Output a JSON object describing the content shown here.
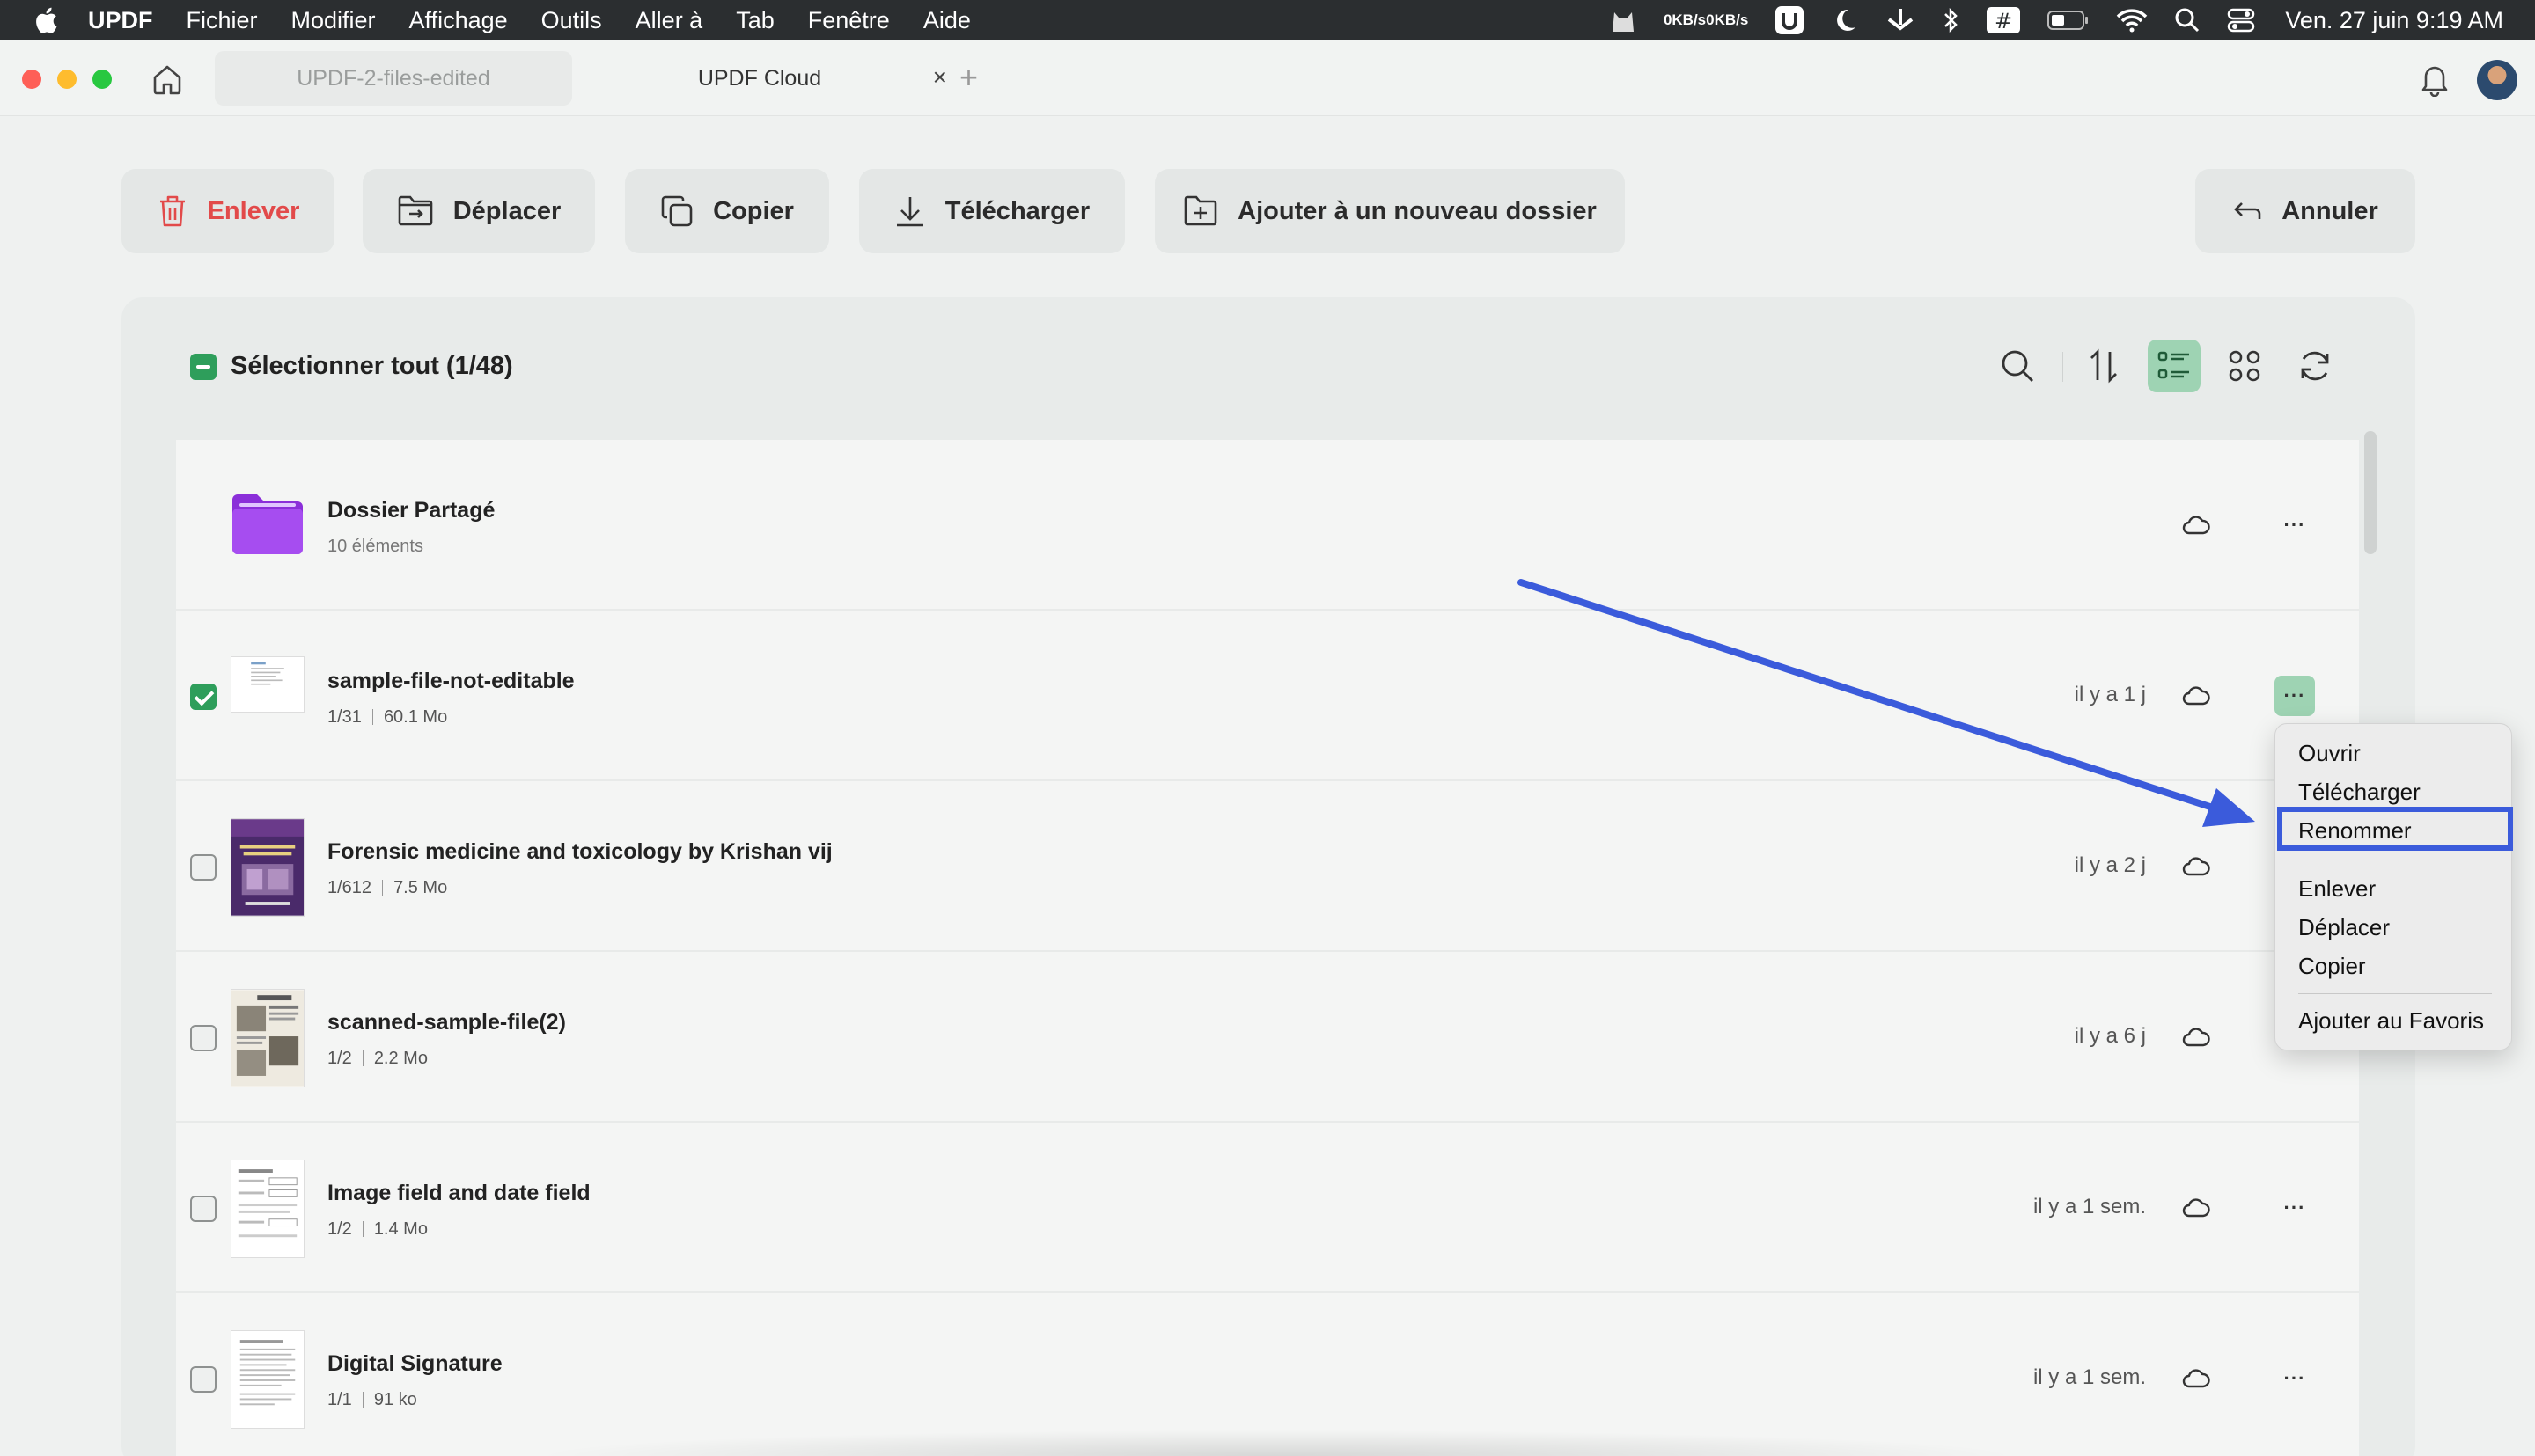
{
  "menubar": {
    "app_name": "UPDF",
    "items": [
      "Fichier",
      "Modifier",
      "Affichage",
      "Outils",
      "Aller à",
      "Tab",
      "Fenêtre",
      "Aide"
    ],
    "network_up": "0KB/s",
    "network_down": "0KB/s",
    "clock": "Ven. 27 juin  9:19 AM"
  },
  "tabs": [
    {
      "label": "UPDF-2-files-edited",
      "active": false
    },
    {
      "label": "UPDF Cloud",
      "active": true
    }
  ],
  "tab_close": "×",
  "new_tab": "+",
  "toolbar": {
    "remove": "Enlever",
    "move": "Déplacer",
    "copy": "Copier",
    "download": "Télécharger",
    "add_folder": "Ajouter à un nouveau dossier",
    "cancel": "Annuler"
  },
  "list_header": {
    "select_all": "Sélectionner tout (1/48)"
  },
  "files": [
    {
      "name": "Dossier Partagé",
      "meta": "10 éléments",
      "type": "folder",
      "time": ""
    },
    {
      "name": "sample-file-not-editable",
      "pages": "1/31",
      "size": "60.1 Mo",
      "time": "il y a 1 j",
      "checked": true
    },
    {
      "name": "Forensic medicine and toxicology  by Krishan vij",
      "pages": "1/612",
      "size": "7.5 Mo",
      "time": "il y a 2 j",
      "checked": false
    },
    {
      "name": "scanned-sample-file(2)",
      "pages": "1/2",
      "size": "2.2 Mo",
      "time": "il y a 6 j",
      "checked": false
    },
    {
      "name": "Image field and date field",
      "pages": "1/2",
      "size": "1.4 Mo",
      "time": "il y a 1 sem.",
      "checked": false
    },
    {
      "name": "Digital Signature",
      "pages": "1/1",
      "size": "91 ko",
      "time": "il y a 1 sem.",
      "checked": false
    }
  ],
  "more_label": "···",
  "context_menu": {
    "items": [
      "Ouvrir",
      "Télécharger",
      "Renommer",
      "Enlever",
      "Déplacer",
      "Copier",
      "Ajouter au Favoris"
    ],
    "highlighted": "Renommer"
  },
  "colors": {
    "accent_green": "#2e9e5b",
    "selected_bg": "#9ed3b3",
    "danger": "#e24a4a",
    "annotation_blue": "#3b5bdb",
    "folder_purple": "#9b3de8"
  }
}
